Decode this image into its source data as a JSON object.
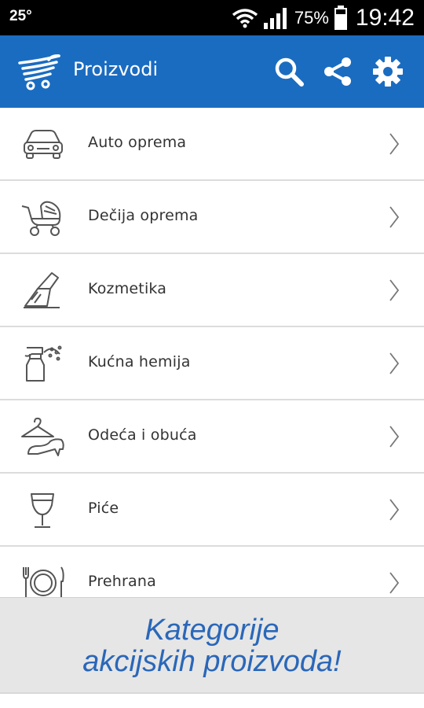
{
  "status_bar": {
    "temperature": "25°",
    "battery_percent": "75%",
    "time": "19:42",
    "icons": [
      "wifi-icon",
      "signal-icon",
      "battery-icon"
    ]
  },
  "app_bar": {
    "title": "Proizvodi",
    "logo_icon": "shopping-cart-icon",
    "actions": [
      "search-icon",
      "share-icon",
      "settings-icon"
    ],
    "color": "#1a6cc1"
  },
  "categories": [
    {
      "label": "Auto oprema",
      "icon": "car-icon"
    },
    {
      "label": "Dečija oprema",
      "icon": "stroller-icon"
    },
    {
      "label": "Kozmetika",
      "icon": "cosmetics-icon"
    },
    {
      "label": "Kućna hemija",
      "icon": "spray-bottle-icon"
    },
    {
      "label": "Odeća i obuća",
      "icon": "hanger-shoe-icon"
    },
    {
      "label": "Piće",
      "icon": "wine-glass-icon"
    },
    {
      "label": "Prehrana",
      "icon": "plate-cutlery-icon"
    }
  ],
  "banner": {
    "line1": "Kategorije",
    "line2": "akcijskih proizvoda!",
    "text_color": "#2a67b9"
  }
}
